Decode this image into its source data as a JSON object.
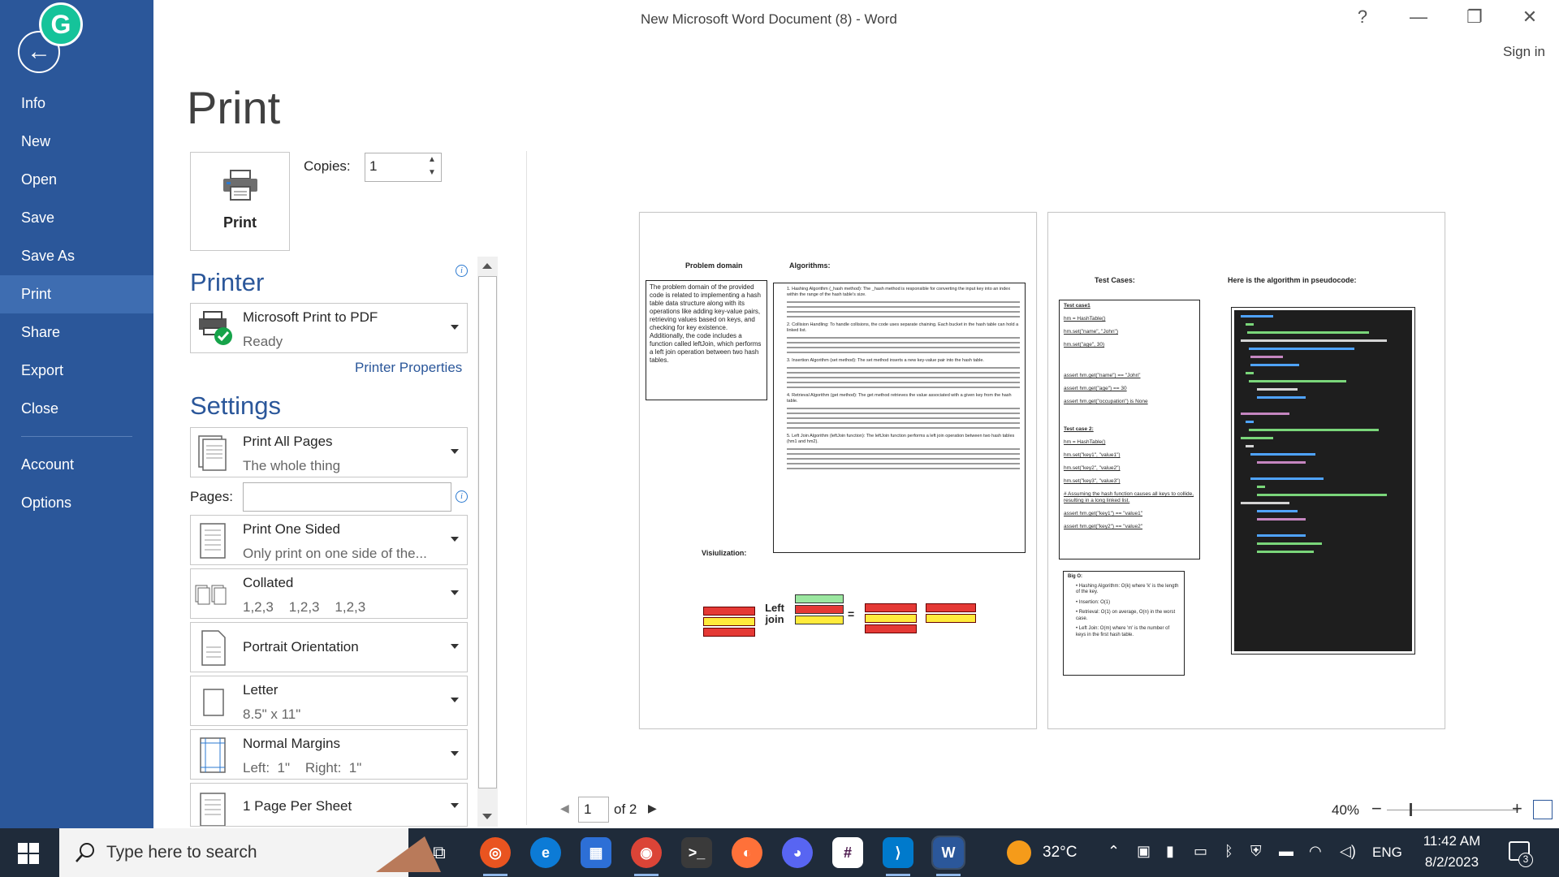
{
  "window": {
    "title": "New Microsoft Word Document (8) - Word",
    "help": "?",
    "minimize": "—",
    "restore": "❐",
    "close": "✕",
    "sign_in": "Sign in"
  },
  "sidebar": {
    "grammarly_letter": "G",
    "back_glyph": "←",
    "items": [
      {
        "label": "Info"
      },
      {
        "label": "New"
      },
      {
        "label": "Open"
      },
      {
        "label": "Save"
      },
      {
        "label": "Save As"
      },
      {
        "label": "Print",
        "active": true
      },
      {
        "label": "Share"
      },
      {
        "label": "Export"
      },
      {
        "label": "Close"
      },
      {
        "label": "Account"
      },
      {
        "label": "Options"
      }
    ]
  },
  "print": {
    "heading": "Print",
    "button_label": "Print",
    "copies_label": "Copies:",
    "copies_value": "1",
    "printer_section": "Printer",
    "printer_name": "Microsoft Print to PDF",
    "printer_status": "Ready",
    "printer_properties": "Printer Properties",
    "settings_section": "Settings",
    "pages_label": "Pages:",
    "pages_value": "",
    "info_glyph": "i",
    "settings": [
      {
        "main": "Print All Pages",
        "sub": "The whole thing",
        "icon": "pages-icon"
      },
      {
        "main": "Print One Sided",
        "sub": "Only print on one side of the...",
        "icon": "one-sided-icon"
      },
      {
        "main": "Collated",
        "sub": "1,2,3    1,2,3    1,2,3",
        "icon": "collated-icon"
      },
      {
        "main": "Portrait Orientation",
        "sub": "",
        "icon": "portrait-icon"
      },
      {
        "main": "Letter",
        "sub": "8.5\" x 11\"",
        "icon": "paper-icon"
      },
      {
        "main": "Normal Margins",
        "sub": "Left:  1\"    Right:  1\"",
        "icon": "margins-icon"
      },
      {
        "main": "1 Page Per Sheet",
        "sub": "",
        "icon": "sheet-icon"
      }
    ]
  },
  "preview": {
    "page1": {
      "problem_heading": "Problem domain",
      "algorithms_heading": "Algorithms:",
      "problem_text": "The problem domain of the provided code is related to implementing a hash table data structure along with its operations like adding key-value pairs, retrieving values based on keys, and checking for key existence. Additionally, the code includes a function called leftJoin, which performs a left join operation between two hash tables.",
      "algorithm_items": [
        "Hashing Algorithm (_hash method): The _hash method is responsible for converting the input key into an index within the range of the hash table's size.",
        "Collision Handling: To handle collisions, the code uses separate chaining. Each bucket in the hash table can hold a linked list.",
        "Insertion Algorithm (set method): The set method inserts a new key-value pair into the hash table.",
        "Retrieval Algorithm (get method): The get method retrieves the value associated with a given key from the hash table.",
        "Left Join Algorithm (leftJoin function): The leftJoin function performs a left join operation between two hash tables (hm1 and hm2)."
      ],
      "visualization_heading": "Visiulization:",
      "left_join_label": "Left join",
      "equals_sign": "="
    },
    "page2": {
      "test_cases_heading": "Test Cases:",
      "pseudocode_heading": "Here is the algorithm in pseudocode:",
      "test_lines": [
        "Test case1",
        "hm = HashTable()",
        "hm.set(\"name\", \"John\")",
        "hm.set(\"age\", 30)",
        "assert hm.get(\"name\") == \"John\"",
        "assert hm.get(\"age\") == 30",
        "assert hm.get(\"occupation\") is None",
        "Test case 2:",
        "hm = HashTable()",
        "hm.set(\"key1\", \"value1\")",
        "hm.set(\"key2\", \"value2\")",
        "hm.set(\"key3\", \"value3\")",
        "# Assuming the hash function causes all keys to collide, resulting in a long linked list.",
        "assert hm.get(\"key1\") == \"value1\"",
        "assert hm.get(\"key2\") == \"value2\""
      ],
      "big_o_heading": "Big O:",
      "big_o_items": [
        "Hashing Algorithm: O(k) where 'k' is the length of the key.",
        "Insertion: O(1)",
        "Retrieval: O(1) on average, O(n) in the worst case.",
        "Left Join: O(m) where 'm' is the number of keys in the first hash table."
      ]
    },
    "page_number": "1",
    "page_of": "of 2",
    "zoom": "40%",
    "zoom_minus": "−",
    "zoom_plus": "+"
  },
  "taskbar": {
    "search_placeholder": "Type here to search",
    "weather_temp": "32°C",
    "language": "ENG",
    "time": "11:42 AM",
    "date": "8/2/2023",
    "notification_count": "3"
  },
  "colors": {
    "word_blue": "#2b579a",
    "sidebar_active": "#3e6db1",
    "taskbar": "#1f2b3a"
  }
}
